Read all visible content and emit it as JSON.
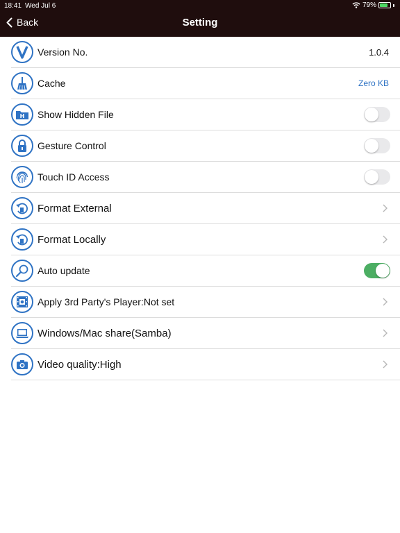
{
  "status_bar": {
    "time": "18:41",
    "date": "Wed Jul 6",
    "battery": "79%",
    "battery_level": 0.79
  },
  "header": {
    "back_label": "Back",
    "title": "Setting",
    "background": "#1f0d0d"
  },
  "colors": {
    "accent": "#2f73c4",
    "toggle_on": "#4cae63",
    "toggle_off": "#e9e9eb",
    "divider": "#dcdcdc"
  },
  "settings": [
    {
      "id": "version",
      "icon": "v-letter-icon",
      "label": "Version No.",
      "type": "value",
      "value": "1.0.4"
    },
    {
      "id": "cache",
      "icon": "broom-icon",
      "label": "Cache",
      "type": "value",
      "value": "Zero KB"
    },
    {
      "id": "hidden-file",
      "icon": "hidden-folder-icon",
      "label": "Show Hidden File",
      "type": "toggle",
      "on": false
    },
    {
      "id": "gesture",
      "icon": "lock-icon",
      "label": "Gesture Control",
      "type": "toggle",
      "on": false
    },
    {
      "id": "touch-id",
      "icon": "fingerprint-icon",
      "label": "Touch ID Access",
      "type": "toggle",
      "on": false
    },
    {
      "id": "format-external",
      "icon": "format-undo-icon",
      "label": "Format External",
      "type": "chevron"
    },
    {
      "id": "format-locally",
      "icon": "format-undo-icon",
      "label": "Format Locally",
      "type": "chevron"
    },
    {
      "id": "auto-update",
      "icon": "magnifier-icon",
      "label": "Auto update",
      "type": "toggle",
      "on": true
    },
    {
      "id": "player",
      "icon": "film-icon",
      "label": "Apply 3rd Party's Player:Not set",
      "type": "chevron"
    },
    {
      "id": "samba",
      "icon": "laptop-icon",
      "label": "Windows/Mac share(Samba)",
      "type": "chevron"
    },
    {
      "id": "video-quality",
      "icon": "camera-icon",
      "label": "Video quality:High",
      "type": "chevron"
    }
  ]
}
